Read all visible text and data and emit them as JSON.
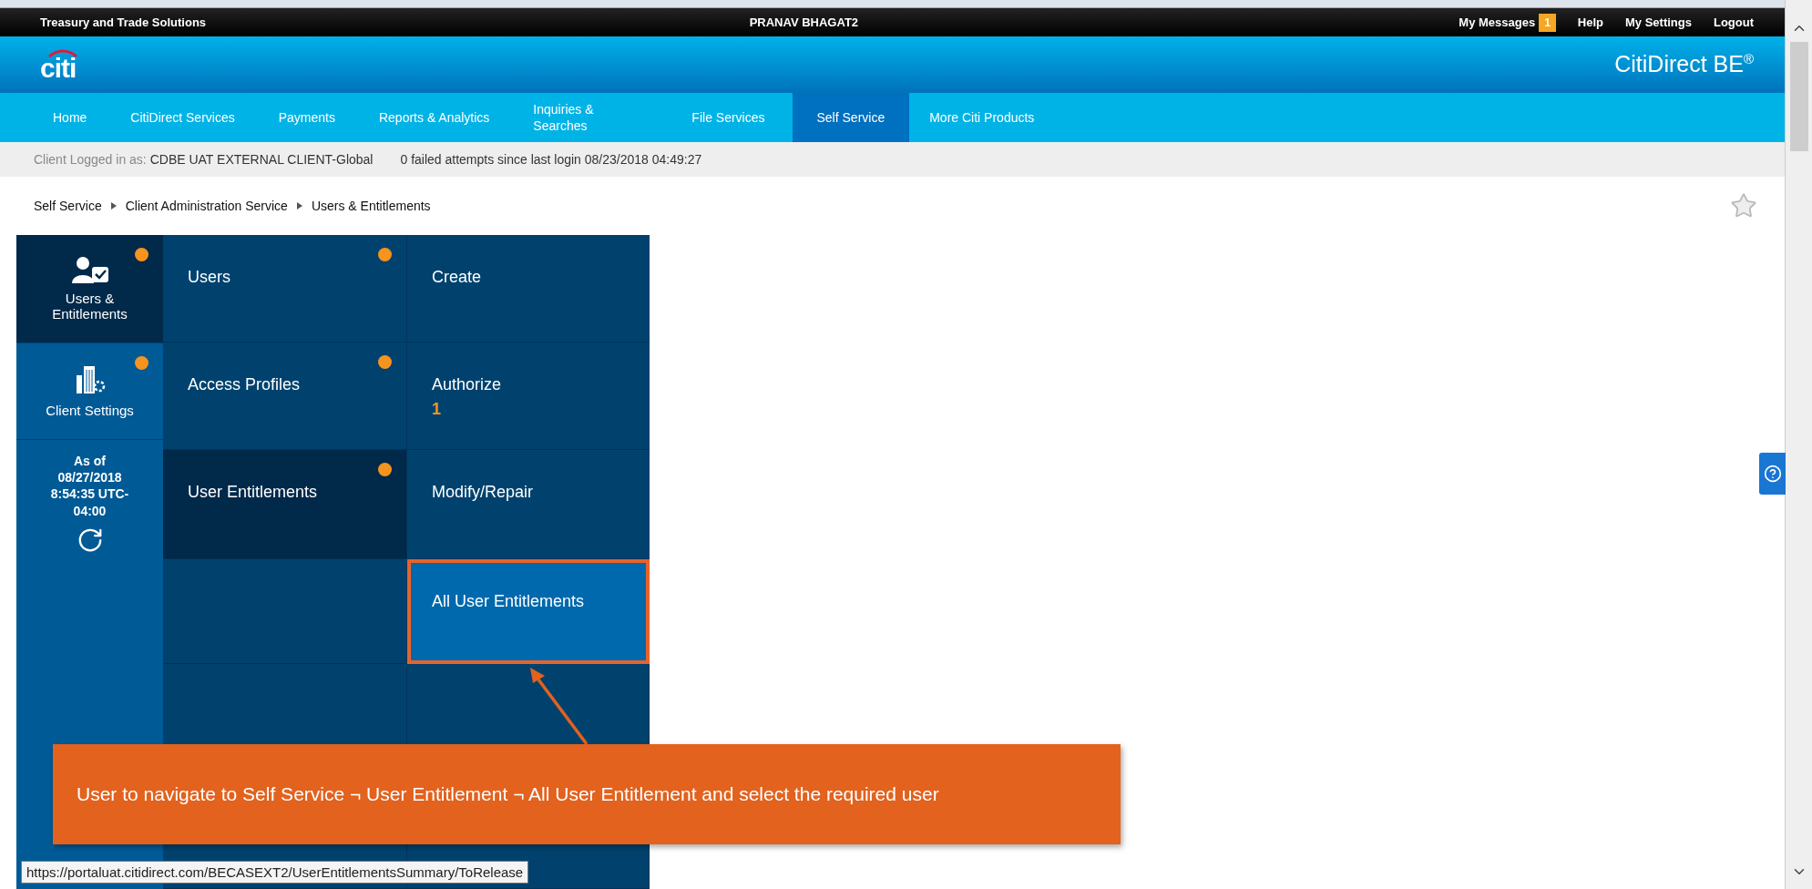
{
  "top_bar": {
    "brand": "Treasury and Trade Solutions",
    "user": "PRANAV BHAGAT2",
    "links": [
      {
        "label": "My Messages",
        "badge": "1"
      },
      {
        "label": "Help"
      },
      {
        "label": "My Settings"
      },
      {
        "label": "Logout"
      }
    ]
  },
  "header": {
    "logo": "citi",
    "product": "CitiDirect BE$^{®}$"
  },
  "nav": [
    {
      "label": "Home",
      "selected": false
    },
    {
      "label": "CitiDirect Services",
      "selected": false
    },
    {
      "label": "Payments",
      "selected": false
    },
    {
      "label": "Reports & Analytics",
      "selected": false
    },
    {
      "label": "Inquiries & Searches",
      "selected": false
    },
    {
      "label": "File Services",
      "selected": false
    },
    {
      "label": "Self Service",
      "selected": true
    },
    {
      "label": "More Citi Products",
      "selected": false
    }
  ],
  "info_bar": {
    "label": "Client Logged in as:",
    "client": "CDBE UAT EXTERNAL CLIENT-Global",
    "attempts": "0 failed attempts since last login 08/23/2018 04:49:27"
  },
  "breadcrumb": [
    "Self Service",
    "Client Administration Service",
    "Users & Entitlements"
  ],
  "side_tiles": [
    {
      "kind": "users",
      "label": "Users & Entitlements",
      "selected": true,
      "dot": true
    },
    {
      "kind": "settings",
      "label": "Client Settings",
      "selected": false,
      "dot": true
    }
  ],
  "as_of": [
    "As of",
    "08/27/2018",
    "8:54:35 UTC-",
    "04:00"
  ],
  "categories": [
    {
      "label": "Users",
      "selected": false,
      "dot": true
    },
    {
      "label": "Access Profiles",
      "selected": false,
      "dot": true
    },
    {
      "label": "User Entitlements",
      "selected": true,
      "dot": true
    }
  ],
  "actions": [
    {
      "label": "Create",
      "highlighted": false
    },
    {
      "label": "Authorize",
      "count": "1",
      "highlighted": false
    },
    {
      "label": "Modify/Repair",
      "highlighted": false
    },
    {
      "label": "All User Entitlements",
      "highlighted": true
    }
  ],
  "callout": "User to navigate to Self Service ¬ User Entitlement ¬ All User Entitlement and select the required user",
  "status_url": "https://portaluat.citidirect.com/BECASEXT2/UserEntitlementsSummary/ToRelease"
}
